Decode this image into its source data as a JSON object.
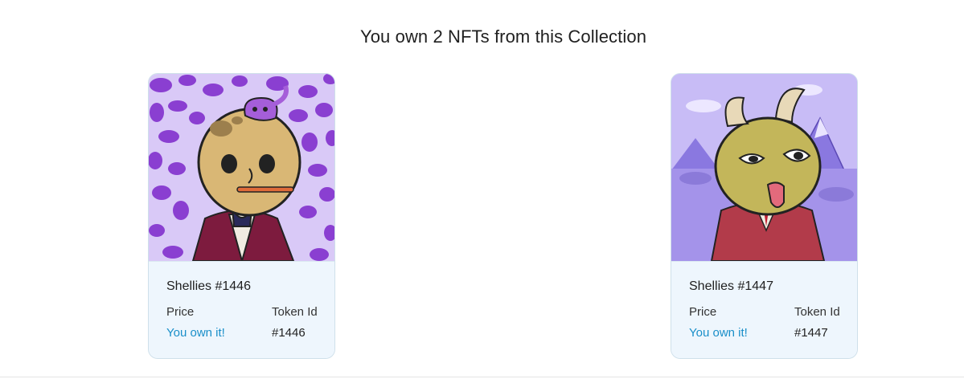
{
  "heading": "You own 2 NFTs from this Collection",
  "colors": {
    "accent": "#1a8fc9",
    "card_bg": "#eef6fd",
    "card_border": "#cfe0ea"
  },
  "nfts": [
    {
      "name": "Shellies #1446",
      "price_label": "Price",
      "price_value": "You own it!",
      "token_label": "Token Id",
      "token_value": "#1446"
    },
    {
      "name": "Shellies #1447",
      "price_label": "Price",
      "price_value": "You own it!",
      "token_label": "Token Id",
      "token_value": "#1447"
    }
  ]
}
